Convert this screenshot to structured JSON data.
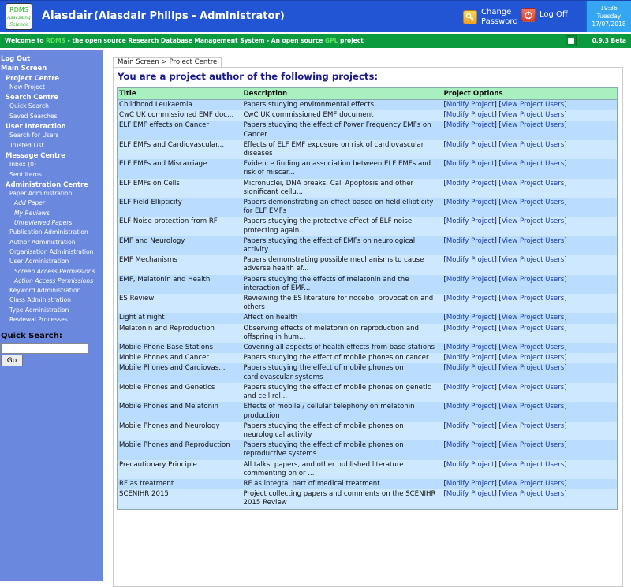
{
  "header": {
    "logo": {
      "line1": "RDMS",
      "line2": "Assessing",
      "line3": "Science"
    },
    "username": "Alasdair",
    "full_name": "(Alasdair Philips - Administrator)",
    "change_password": {
      "line1": "Change",
      "line2": "Password",
      "icon": "key-icon"
    },
    "log_off": {
      "label": "Log Off",
      "icon": "power-icon"
    },
    "clock": {
      "time": "19:36",
      "day": "Tuesday",
      "date": "17/07/2018"
    }
  },
  "banner": {
    "prefix": "Welcome to ",
    "rdms": "RDMS",
    "middle": " - the open source Research Database Management System - An open source ",
    "gpl": "GPL",
    "suffix": " project",
    "version": "0.9.3 Beta"
  },
  "sidebar": {
    "items": [
      {
        "label": "Log Out",
        "level": 0
      },
      {
        "label": "Main Screen",
        "level": 0
      },
      {
        "label": "Project Centre",
        "level": 1
      },
      {
        "label": "New Project",
        "level": 2
      },
      {
        "label": "Search Centre",
        "level": 1
      },
      {
        "label": "Quick Search",
        "level": 2
      },
      {
        "label": "Saved Searches",
        "level": 2
      },
      {
        "label": "User Interaction",
        "level": 1
      },
      {
        "label": "Search for Users",
        "level": 2
      },
      {
        "label": "Trusted List",
        "level": 2
      },
      {
        "label": "Message Centre",
        "level": 1
      },
      {
        "label": "Inbox (0)",
        "level": 2
      },
      {
        "label": "Sent Items",
        "level": 2
      },
      {
        "label": "Administration Centre",
        "level": 1
      },
      {
        "label": "Paper Administration",
        "level": 2
      },
      {
        "label": "Add Paper",
        "level": 3
      },
      {
        "label": "My Reviews",
        "level": 3
      },
      {
        "label": "Unreviewed Papers",
        "level": 3
      },
      {
        "label": "Publication Administration",
        "level": 2
      },
      {
        "label": "Author Administration",
        "level": 2
      },
      {
        "label": "Organisation Administration",
        "level": 2
      },
      {
        "label": "User Administration",
        "level": 2
      },
      {
        "label": "Screen Access Permissions",
        "level": 3
      },
      {
        "label": "Action Access Permissions",
        "level": 3
      },
      {
        "label": "Keyword Administration",
        "level": 2
      },
      {
        "label": "Class Administration",
        "level": 2
      },
      {
        "label": "Type Administration",
        "level": 2
      },
      {
        "label": "Reviewal Processes",
        "level": 2
      }
    ],
    "quick_search": {
      "label": "Quick Search:",
      "value": "",
      "button": "Go"
    }
  },
  "main": {
    "breadcrumb": "Main Screen > Project Centre",
    "heading": "You are a project author of the following projects:",
    "columns": [
      "Title",
      "Description",
      "Project Options"
    ],
    "option_labels": {
      "modify": "Modify Project",
      "users": "View Project Users"
    },
    "projects": [
      {
        "title": "Childhood Leukaemia",
        "description": "Papers studying environmental effects"
      },
      {
        "title": "CwC UK commissioned EMF doc...",
        "description": "CwC UK commissioned EMF document"
      },
      {
        "title": "ELF EMF effects on Cancer",
        "description": "Papers studying the effect of Power Frequency EMFs on Cancer"
      },
      {
        "title": "ELF EMFs and Cardiovascular...",
        "description": "Effects of ELF EMF exposure on risk of cardiovascular diseases"
      },
      {
        "title": "ELF EMFs and Miscarriage",
        "description": "Evidence finding an association between ELF EMFs and risk of miscar..."
      },
      {
        "title": "ELF EMFs on Cells",
        "description": "Micronuclei, DNA breaks, Call Apoptosis and other significant cellu..."
      },
      {
        "title": "ELF Field Ellipticity",
        "description": "Papers demonstrating an effect based on field ellipticity for ELF EMFs"
      },
      {
        "title": "ELF Noise protection from RF",
        "description": "Papers studying the protective effect of ELF noise protecting again..."
      },
      {
        "title": "EMF and Neurology",
        "description": "Papers studying the effect of EMFs on neurological activity"
      },
      {
        "title": "EMF Mechanisms",
        "description": "Papers demonstrating possible mechanisms to cause adverse health ef..."
      },
      {
        "title": "EMF, Melatonin and Health",
        "description": "Papers studying the effects of melatonin and the interaction of EMF..."
      },
      {
        "title": "ES Review",
        "description": "Reviewing the ES literature for nocebo, provocation and others"
      },
      {
        "title": "Light at night",
        "description": "Affect on health"
      },
      {
        "title": "Melatonin and Reproduction",
        "description": "Observing effects of melatonin on reproduction and offspring in hum..."
      },
      {
        "title": "Mobile Phone Base Stations",
        "description": "Covering all aspects of health effects from base stations"
      },
      {
        "title": "Mobile Phones and Cancer",
        "description": "Papers studying the effect of mobile phones on cancer"
      },
      {
        "title": "Mobile Phones and Cardiovas...",
        "description": "Papers studying the effect of mobile phones on cardiovascular systems"
      },
      {
        "title": "Mobile Phones and Genetics",
        "description": "Papers studying the effect of mobile phones on genetic and cell rel..."
      },
      {
        "title": "Mobile Phones and Melatonin",
        "description": "Effects of mobile / cellular telephony on melatonin production"
      },
      {
        "title": "Mobile Phones and Neurology",
        "description": "Papers studying the effect of mobile phones on neurological activity"
      },
      {
        "title": "Mobile Phones and Reproduction",
        "description": "Papers studying the effect of mobile phones on reproductive systems"
      },
      {
        "title": "Precautionary Principle",
        "description": "All talks, papers, and other published literature commenting on or ..."
      },
      {
        "title": "RF as treatment",
        "description": "RF as integral part of medical treatment"
      },
      {
        "title": "SCENIHR 2015",
        "description": "Project collecting papers and comments on the SCENIHR 2015 Review"
      }
    ]
  },
  "colors": {
    "header_bg": "#2255d4",
    "banner_bg": "#0c9a3e",
    "sidebar_bg": "#6b88df",
    "table_header_bg": "#a8f0c0",
    "row_odd": "#b9dcff",
    "row_even": "#cde8ff",
    "heading": "#1a1a8c",
    "link": "#1a3aa8"
  }
}
